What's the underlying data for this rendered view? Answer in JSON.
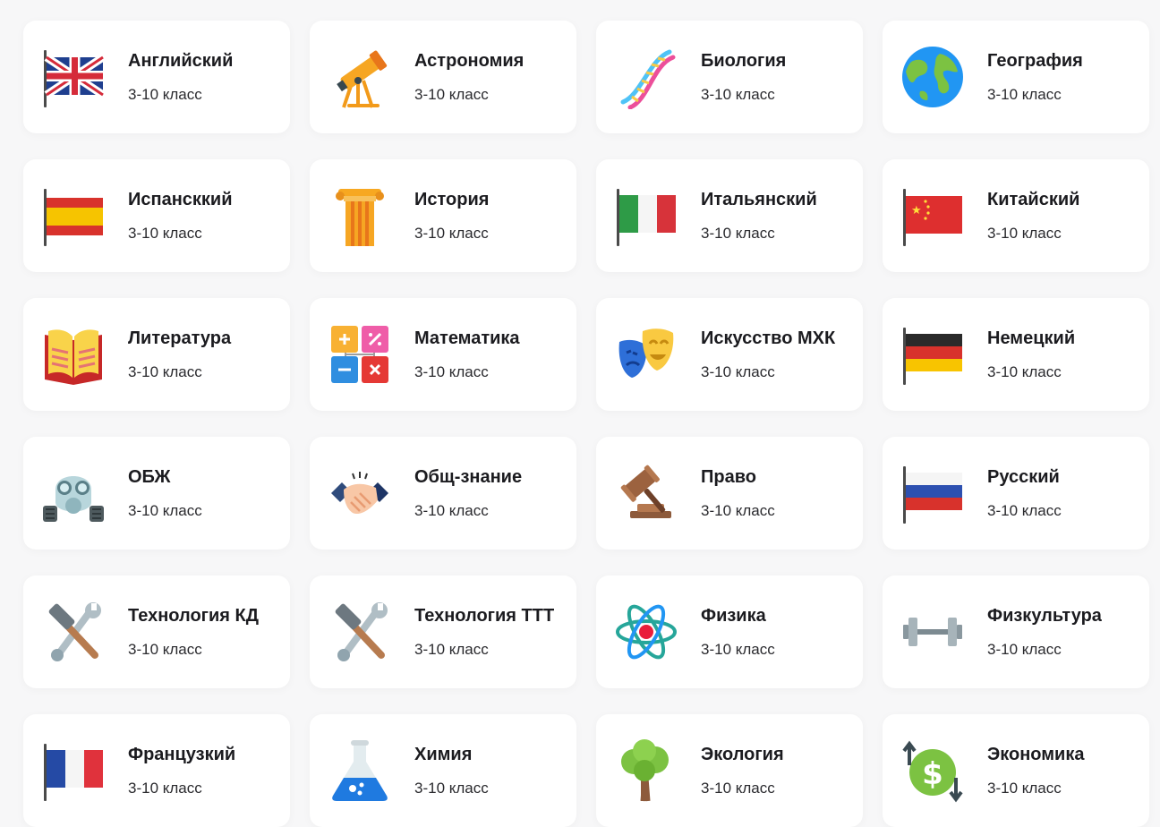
{
  "subjects": [
    {
      "title": "Английский",
      "grade": "3-10 класс",
      "icon": "uk-flag-icon"
    },
    {
      "title": "Астрономия",
      "grade": "3-10 класс",
      "icon": "telescope-icon"
    },
    {
      "title": "Биология",
      "grade": "3-10 класс",
      "icon": "dna-icon"
    },
    {
      "title": "География",
      "grade": "3-10 класс",
      "icon": "globe-icon"
    },
    {
      "title": "Испансккий",
      "grade": "3-10 класс",
      "icon": "spain-flag-icon"
    },
    {
      "title": "История",
      "grade": "3-10 класс",
      "icon": "column-icon"
    },
    {
      "title": "Итальянский",
      "grade": "3-10 класс",
      "icon": "italy-flag-icon"
    },
    {
      "title": "Китайский",
      "grade": "3-10 класс",
      "icon": "china-flag-icon"
    },
    {
      "title": "Литература",
      "grade": "3-10 класс",
      "icon": "open-book-icon"
    },
    {
      "title": "Математика",
      "grade": "3-10 класс",
      "icon": "math-operators-icon"
    },
    {
      "title": "Искусство МХК",
      "grade": "3-10 класс",
      "icon": "theater-masks-icon"
    },
    {
      "title": "Немецкий",
      "grade": "3-10 класс",
      "icon": "germany-flag-icon"
    },
    {
      "title": "ОБЖ",
      "grade": "3-10 класс",
      "icon": "gas-mask-icon"
    },
    {
      "title": "Общ-знание",
      "grade": "3-10 класс",
      "icon": "handshake-icon"
    },
    {
      "title": "Право",
      "grade": "3-10 класс",
      "icon": "gavel-icon"
    },
    {
      "title": "Русский",
      "grade": "3-10 класс",
      "icon": "russia-flag-icon"
    },
    {
      "title": "Технология КД",
      "grade": "3-10 класс",
      "icon": "tools-icon"
    },
    {
      "title": "Технология ТТТ",
      "grade": "3-10 класс",
      "icon": "tools-icon"
    },
    {
      "title": "Физика",
      "grade": "3-10 класс",
      "icon": "atom-icon"
    },
    {
      "title": "Физкультура",
      "grade": "3-10 класс",
      "icon": "dumbbell-icon"
    },
    {
      "title": "Французкий",
      "grade": "3-10 класс",
      "icon": "france-flag-icon"
    },
    {
      "title": "Химия",
      "grade": "3-10 класс",
      "icon": "flask-icon"
    },
    {
      "title": "Экология",
      "grade": "3-10 класс",
      "icon": "tree-icon"
    },
    {
      "title": "Экономика",
      "grade": "3-10 класс",
      "icon": "money-exchange-icon"
    }
  ]
}
